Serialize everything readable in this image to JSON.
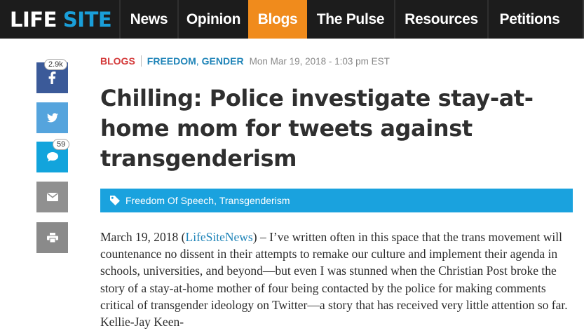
{
  "site": {
    "logo_part1": "LIFE",
    "logo_part2": "SITE"
  },
  "nav": {
    "items": [
      {
        "label": "News"
      },
      {
        "label": "Opinion"
      },
      {
        "label": "Blogs"
      },
      {
        "label": "The Pulse"
      },
      {
        "label": "Resources"
      },
      {
        "label": "Petitions"
      }
    ],
    "active": "Blogs"
  },
  "share": {
    "facebook_count": "2.9k",
    "comments_count": "59",
    "icons": [
      "facebook-icon",
      "twitter-icon",
      "comment-icon",
      "email-icon",
      "print-icon"
    ]
  },
  "article": {
    "section": "BLOGS",
    "categories": [
      "FREEDOM",
      "GENDER"
    ],
    "date": "Mon Mar 19, 2018 - 1:03 pm EST",
    "title": "Chilling: Police investigate stay-at-home mom for tweets against transgenderism",
    "tags": [
      "Freedom Of Speech",
      "Transgenderism"
    ],
    "tag_separator": ", ",
    "body_date": "March 19, 2018 (",
    "body_source": "LifeSiteNews",
    "body_text": ") – I’ve written often in this space that the trans movement will countenance no dissent in their attempts to remake our culture and implement their agenda in schools, universities, and beyond—but even I was stunned when the Christian Post broke the story of a stay-at-home mother of four being contacted by the police for making comments critical of transgender ideology on Twitter—a story that has received very little attention so far. Kellie-Jay Keen-"
  },
  "colors": {
    "nav_bg": "#1c1c1c",
    "nav_active": "#f08b1c",
    "logo_accent": "#1a9fd9",
    "facebook": "#3b5a99",
    "twitter": "#55a4dd",
    "comments": "#12a4dc",
    "tag_bar": "#1aa2de",
    "section_red": "#d43b3b",
    "link_blue": "#1f84b8"
  }
}
